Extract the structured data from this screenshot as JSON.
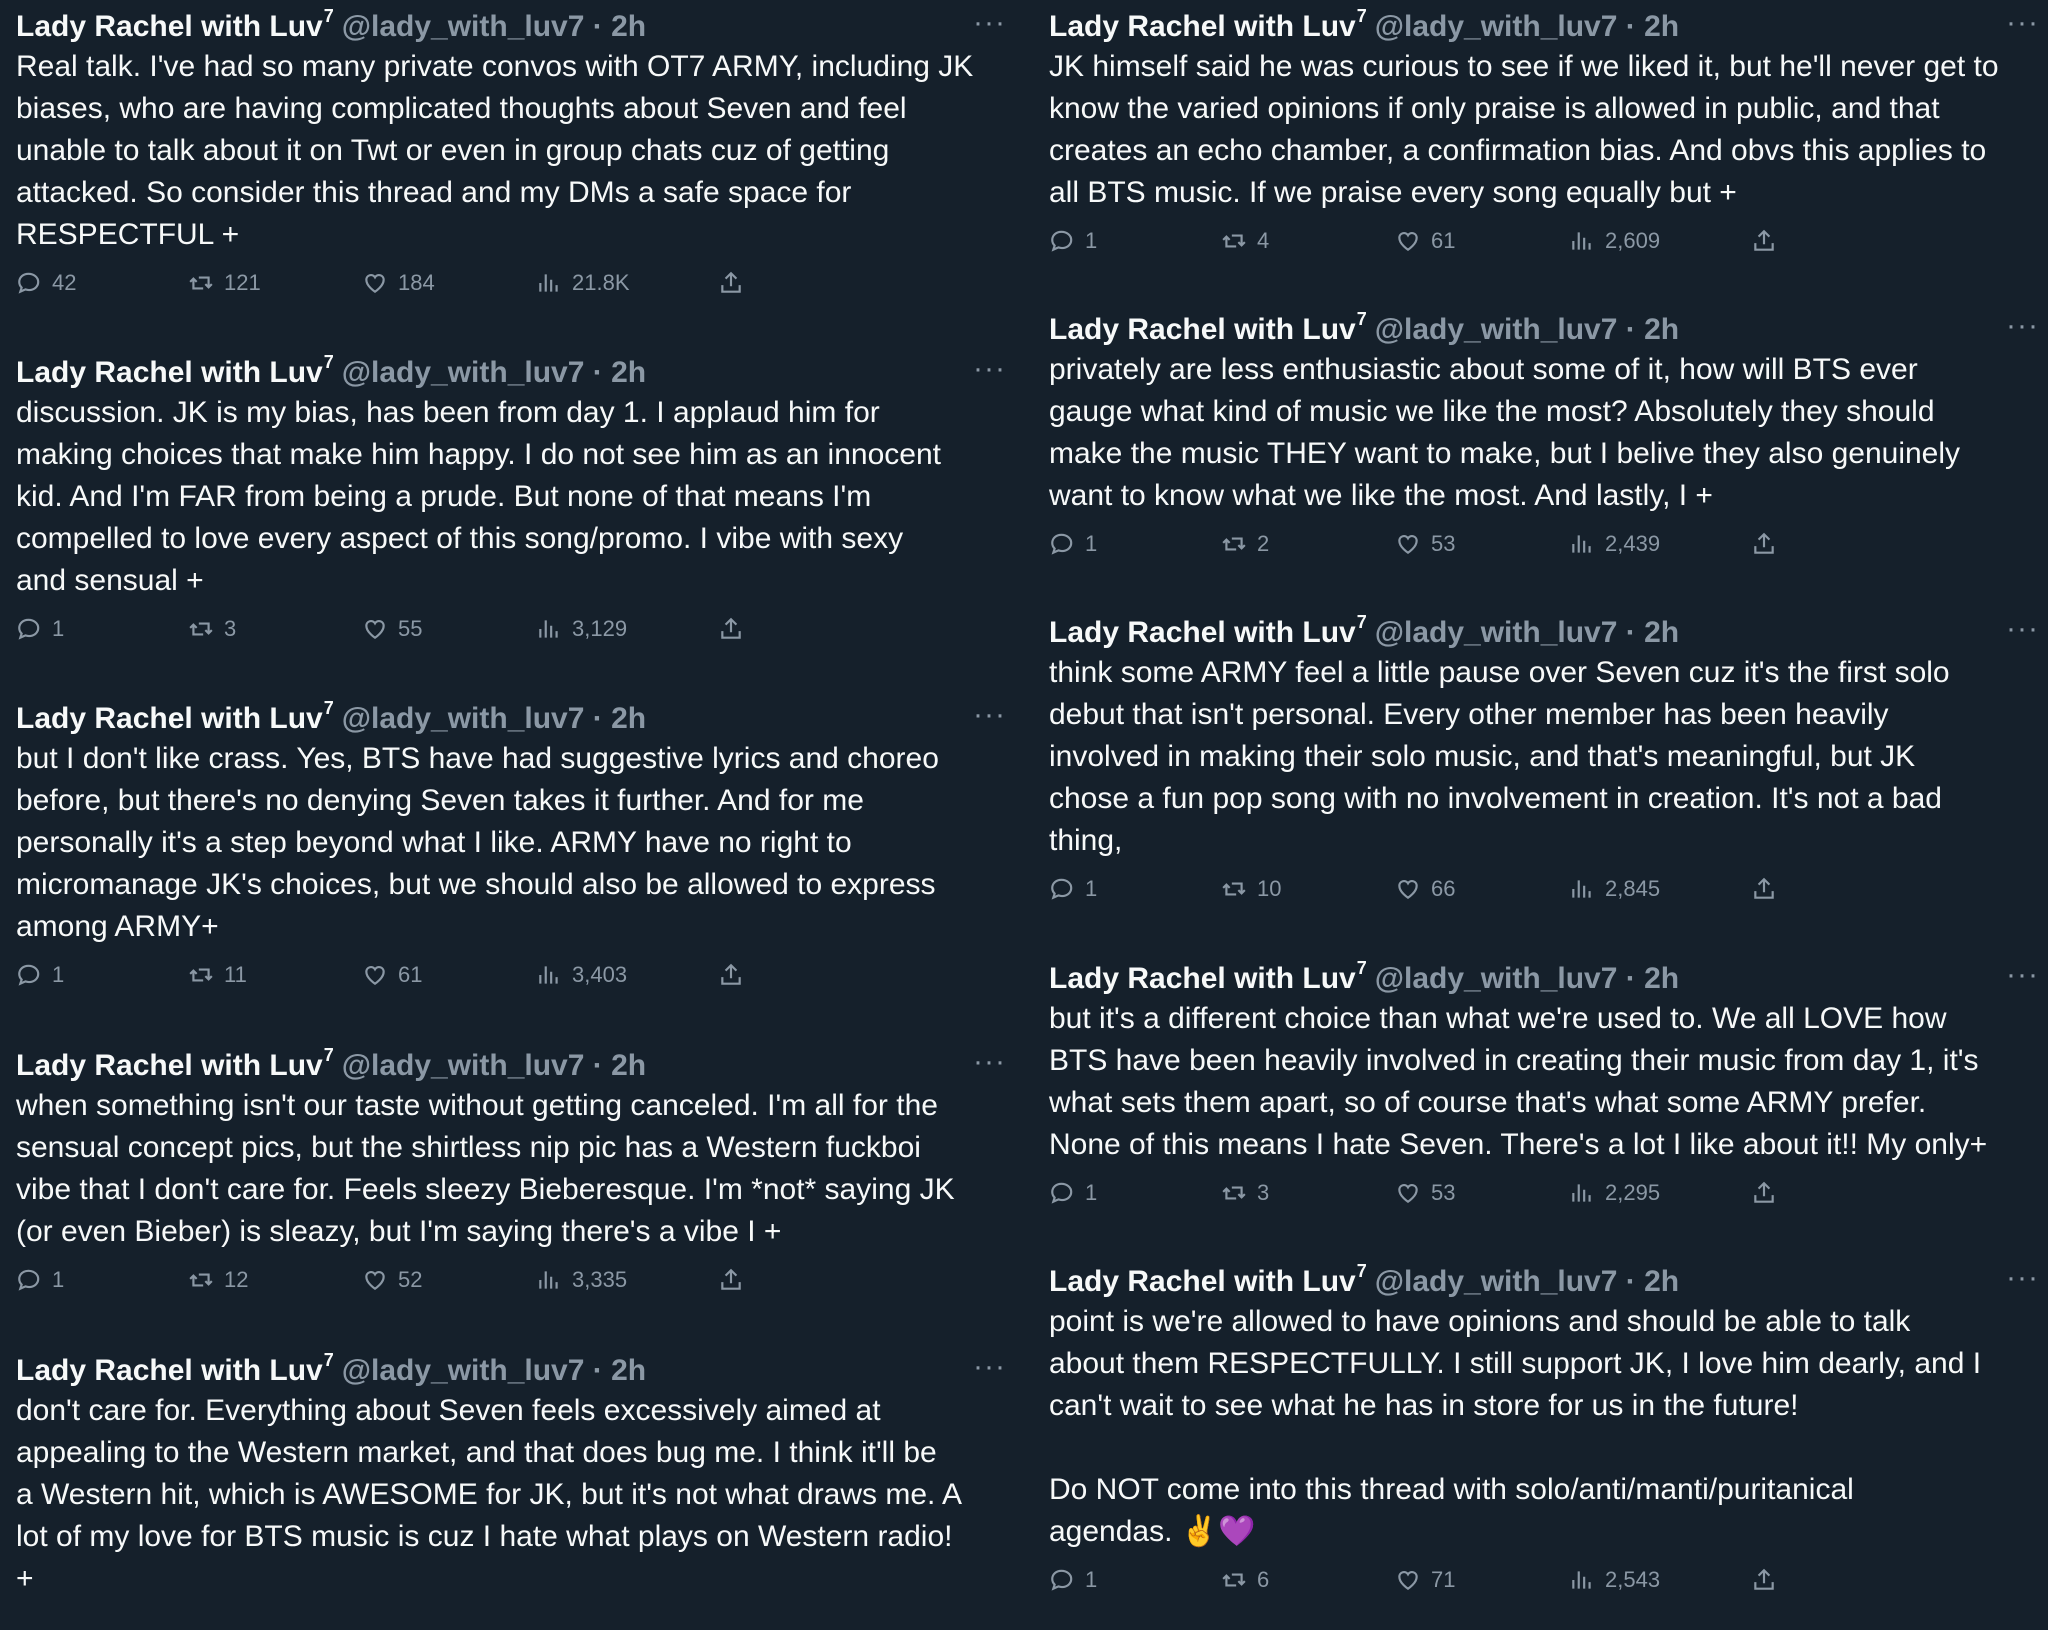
{
  "author": {
    "name": "Lady Rachel with Luv",
    "sup": "7",
    "handle": "@lady_with_luv7",
    "time": "2h"
  },
  "more_glyph": "···",
  "left": [
    {
      "text": "Real talk. I've had so many private convos with OT7 ARMY, including JK\nbiases, who are having complicated thoughts about Seven and feel\nunable to talk about it on Twt or even in group chats cuz of getting\nattacked. So consider this thread and my DMs a safe space for\nRESPECTFUL +",
      "replies": "42",
      "retweets": "121",
      "likes": "184",
      "views": "21.8K"
    },
    {
      "text": "discussion. JK is my bias, has been from day 1. I applaud him for\nmaking choices that make him happy. I do not see him as an innocent\nkid. And I'm FAR from being a prude. But none of that means I'm\ncompelled to love every aspect of this song/promo. I vibe with sexy\nand sensual +",
      "replies": "1",
      "retweets": "3",
      "likes": "55",
      "views": "3,129"
    },
    {
      "text": "but I don't like crass. Yes, BTS have had suggestive lyrics and choreo\nbefore, but there's no denying Seven takes it further. And for me\npersonally it's a step beyond what I like. ARMY have no right to\nmicromanage JK's choices, but we should also be allowed to express\namong ARMY+",
      "replies": "1",
      "retweets": "11",
      "likes": "61",
      "views": "3,403"
    },
    {
      "text": "when something isn't our taste without getting canceled. I'm all for the\nsensual concept pics, but the shirtless nip pic has a Western fuckboi\nvibe that I don't care for. Feels sleezy Bieberesque. I'm *not* saying JK\n(or even Bieber) is sleazy, but I'm saying there's a vibe I +",
      "replies": "1",
      "retweets": "12",
      "likes": "52",
      "views": "3,335"
    },
    {
      "text": "don't care for. Everything about Seven feels excessively aimed at\nappealing to the Western market, and that does bug me. I think it'll be\na Western hit, which is AWESOME for JK, but it's not what draws me. A\nlot of my love for BTS music is cuz I hate what plays on Western radio!\n+",
      "replies": "",
      "retweets": "",
      "likes": "",
      "views": ""
    }
  ],
  "right": [
    {
      "text": "JK himself said he was curious to see if we liked it, but he'll never get to\nknow the varied opinions if only praise is allowed in public, and that\ncreates an echo chamber, a confirmation bias. And obvs this applies to\nall BTS music. If we praise every song equally but +",
      "replies": "1",
      "retweets": "4",
      "likes": "61",
      "views": "2,609"
    },
    {
      "text": "privately are less enthusiastic about some of it, how will BTS ever\ngauge what kind of music we like the most? Absolutely they should\nmake the music THEY want to make, but I belive they also genuinely\nwant to know what we like the most. And lastly, I +",
      "replies": "1",
      "retweets": "2",
      "likes": "53",
      "views": "2,439"
    },
    {
      "text": "think some ARMY feel a little pause over Seven cuz it's the first solo\ndebut that isn't personal. Every other member has been heavily\ninvolved in making their solo music, and that's meaningful, but JK\nchose a fun pop song with no involvement in creation. It's not a bad\nthing,",
      "replies": "1",
      "retweets": "10",
      "likes": "66",
      "views": "2,845"
    },
    {
      "text": "but it's a different choice than what we're used to. We all LOVE how\nBTS have been heavily involved in creating their music from day 1, it's\nwhat sets them apart, so of course that's what some ARMY prefer.\nNone of this means I hate Seven. There's a lot I like about it!! My only+",
      "replies": "1",
      "retweets": "3",
      "likes": "53",
      "views": "2,295"
    },
    {
      "text": "point is we're allowed to have opinions and should be able to talk\nabout them RESPECTFULLY. I still support JK, I love him dearly, and I\ncan't wait to see what he has in store for us in the future!\n\nDo NOT come into this thread with solo/anti/manti/puritanical\nagendas. ✌️💜",
      "replies": "1",
      "retweets": "6",
      "likes": "71",
      "views": "2,543"
    }
  ]
}
